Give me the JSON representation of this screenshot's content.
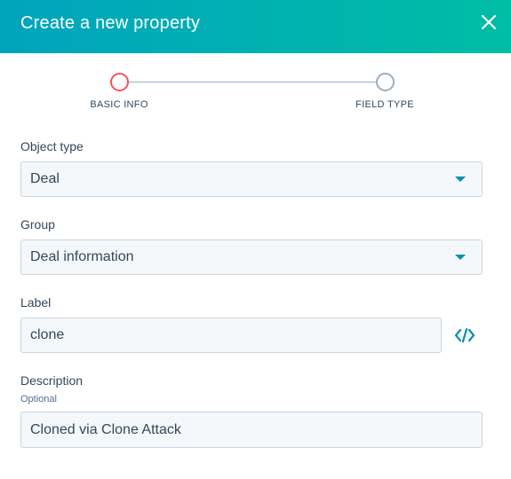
{
  "dialog": {
    "title": "Create a new property"
  },
  "stepper": {
    "steps": [
      {
        "label": "BASIC INFO",
        "state": "active"
      },
      {
        "label": "FIELD TYPE",
        "state": "inactive"
      }
    ]
  },
  "form": {
    "object_type": {
      "label": "Object type",
      "value": "Deal"
    },
    "group": {
      "label": "Group",
      "value": "Deal information"
    },
    "label_field": {
      "label": "Label",
      "value": "clone"
    },
    "description": {
      "label": "Description",
      "sublabel": "Optional",
      "value": "Cloned via Clone Attack"
    }
  },
  "icons": {
    "close": "close-icon",
    "caret": "caret-down-icon",
    "code": "code-icon"
  },
  "colors": {
    "header_start": "#00a4bd",
    "header_end": "#00bda5",
    "active_step": "#f2545b",
    "accent": "#0091ae"
  }
}
